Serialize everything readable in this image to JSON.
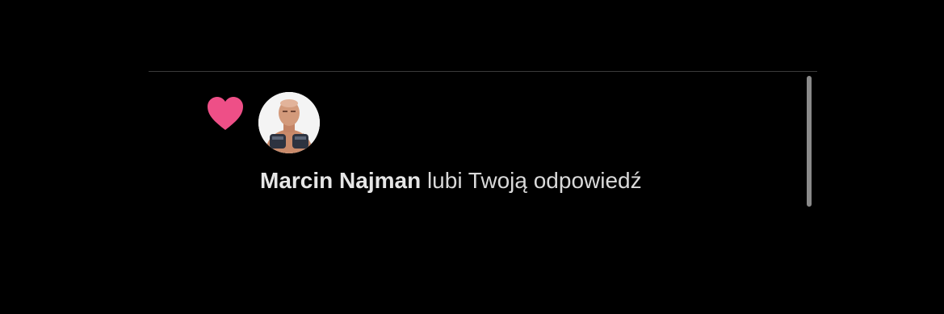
{
  "notification": {
    "icon": "heart-icon",
    "heart_color": "#ee4f87",
    "avatar": "user-avatar-photo",
    "user_name": "Marcin Najman",
    "action_text": " lubi Twoją odpowiedź"
  },
  "colors": {
    "background": "#000000",
    "text": "#d9d9d9",
    "divider": "#3a3a3a",
    "scrollbar": "#8a8a8a"
  }
}
